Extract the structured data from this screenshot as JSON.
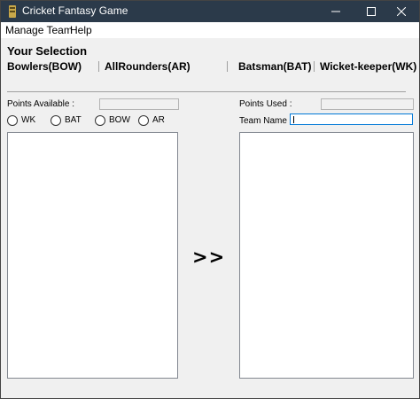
{
  "window": {
    "title": "Cricket Fantasy Game",
    "icon": "cricket-app-icon"
  },
  "menu": {
    "items": [
      "Manage Team",
      "Help"
    ]
  },
  "selection": {
    "title": "Your Selection",
    "roles": {
      "bowlers": "Bowlers(BOW)",
      "allrounders": "AllRounders(AR)",
      "batsman": "Batsman(BAT)",
      "wicketkeeper": "Wicket-keeper(WK)"
    }
  },
  "left": {
    "points_label": "Points Available :",
    "points_value": "",
    "radios": [
      "WK",
      "BAT",
      "BOW",
      "AR"
    ],
    "players": []
  },
  "right": {
    "points_label": "Points Used :",
    "points_value": "",
    "team_name_label": "Team Name :",
    "team_name_value": "",
    "players": []
  },
  "transfer_label": ">>"
}
